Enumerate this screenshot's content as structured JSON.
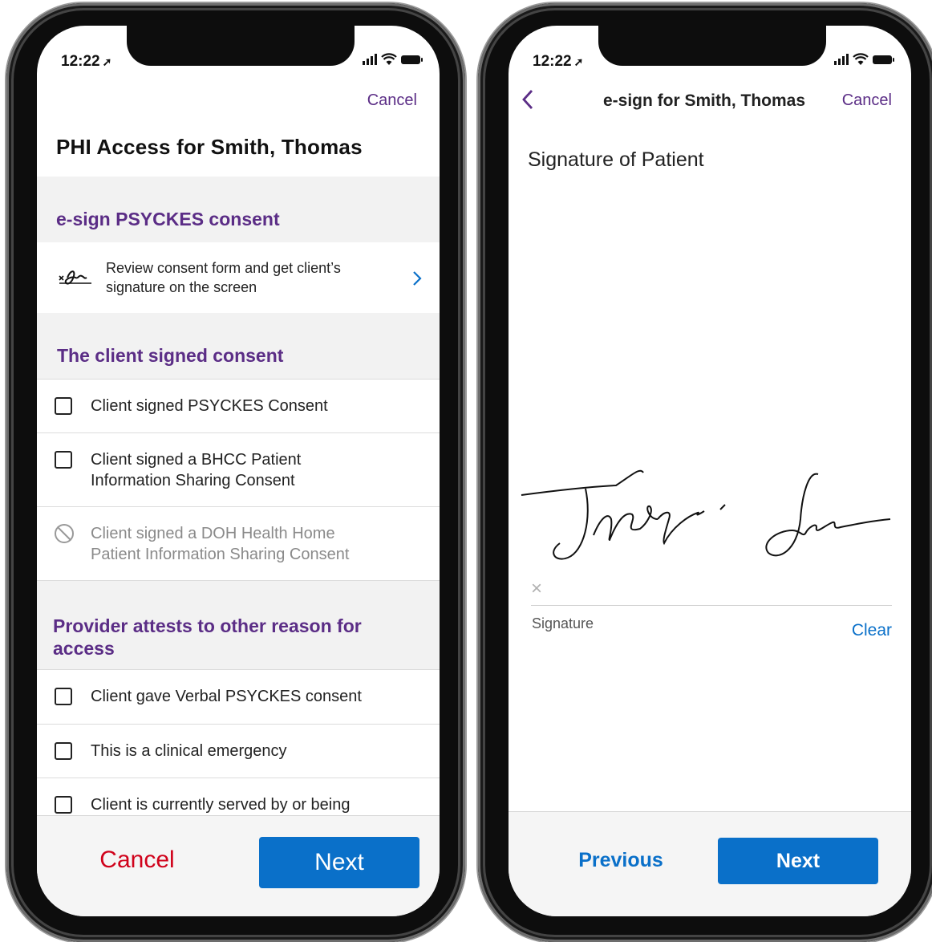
{
  "left_phone": {
    "status": {
      "time": "12:22"
    },
    "header": {
      "cancel_label": "Cancel",
      "title": "PHI Access for Smith, Thomas"
    },
    "esign_section": {
      "heading": "e-sign PSYCKES consent",
      "item": {
        "line1": "Review consent form and get client’s",
        "line2": "signature on the screen",
        "icon": "signature-icon"
      }
    },
    "signed_section": {
      "heading": "The client signed consent",
      "items": [
        {
          "line1": "Client signed PSYCKES Consent",
          "line2": "",
          "state": "unchecked"
        },
        {
          "line1": "Client signed a BHCC Patient",
          "line2": "Information Sharing Consent",
          "state": "unchecked"
        },
        {
          "line1": "Client signed a DOH Health Home",
          "line2": "Patient Information Sharing Consent",
          "state": "disabled"
        }
      ]
    },
    "attest_section": {
      "heading_line1": "Provider attests to other reason for",
      "heading_line2": "access",
      "items": [
        {
          "label": "Client gave Verbal PSYCKES consent"
        },
        {
          "label": "This is a clinical emergency"
        },
        {
          "label": "Client is currently served by or being"
        }
      ]
    },
    "footer": {
      "cancel_label": "Cancel",
      "next_label": "Next"
    }
  },
  "right_phone": {
    "status": {
      "time": "12:22"
    },
    "header": {
      "title": "e-sign for Smith, Thomas",
      "cancel_label": "Cancel"
    },
    "signature_title": "Signature of Patient",
    "signature_pad": {
      "x_mark": "×",
      "label": "Signature",
      "clear_label": "Clear"
    },
    "footer": {
      "previous_label": "Previous",
      "next_label": "Next"
    }
  },
  "colors": {
    "purple": "#5b2d86",
    "blue": "#0a70c9",
    "red": "#d0021b"
  }
}
